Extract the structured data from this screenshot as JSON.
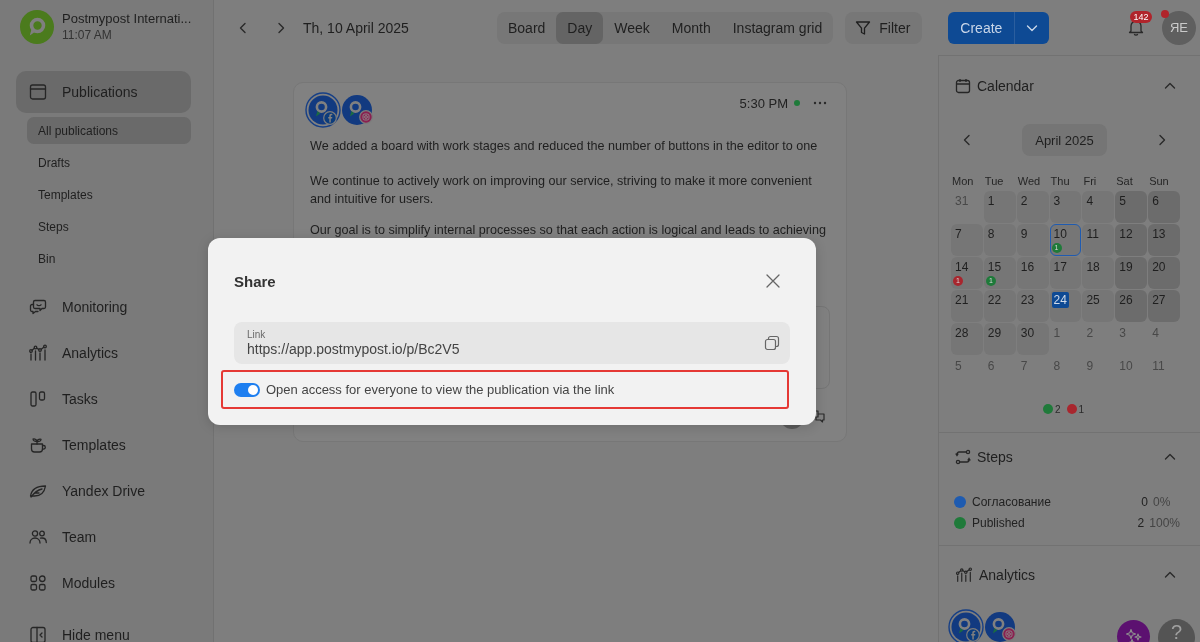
{
  "account": {
    "name": "Postmypost Internati...",
    "time": "11:07 AM"
  },
  "sidebar": {
    "items": [
      {
        "label": "Publications",
        "selected": true,
        "children": [
          {
            "label": "All publications",
            "selected": true
          },
          {
            "label": "Drafts",
            "selected": false
          },
          {
            "label": "Templates",
            "selected": false
          },
          {
            "label": "Steps",
            "selected": false
          },
          {
            "label": "Bin",
            "selected": false
          }
        ]
      },
      {
        "label": "Monitoring",
        "selected": false
      },
      {
        "label": "Analytics",
        "selected": false
      },
      {
        "label": "Tasks",
        "selected": false
      },
      {
        "label": "Templates",
        "selected": false
      },
      {
        "label": "Yandex Drive",
        "selected": false
      },
      {
        "label": "Team",
        "selected": false
      },
      {
        "label": "Modules",
        "selected": false
      },
      {
        "label": "Hide menu",
        "selected": false
      }
    ]
  },
  "toolbar": {
    "date": "Th, 10 April 2025",
    "views": [
      {
        "label": "Board",
        "selected": false
      },
      {
        "label": "Day",
        "selected": true
      },
      {
        "label": "Week",
        "selected": false
      },
      {
        "label": "Month",
        "selected": false
      },
      {
        "label": "Instagram grid",
        "selected": false
      }
    ],
    "filter": "Filter",
    "create": "Create",
    "notifications": "142",
    "profile": {
      "initials": "ЯЕ",
      "alert": true
    }
  },
  "post": {
    "time": "5:30 PM",
    "published": true,
    "accounts": [
      {
        "kind": "facebook",
        "selected": true
      },
      {
        "kind": "instagram",
        "selected": false
      }
    ],
    "paragraphs": [
      "We added a board with work stages and reduced the number of buttons in the editor to one",
      "We continue to actively work on improving our service, striving to make it more convenient and intuitive for users.",
      "Our goal is to simplify internal processes so that each action is logical and leads to achieving"
    ]
  },
  "calendar": {
    "title": "Calendar",
    "expanded": true,
    "month": "April 2025",
    "weekdays": [
      "Mon",
      "Tue",
      "Wed",
      "Thu",
      "Fri",
      "Sat",
      "Sun"
    ],
    "weeks": [
      [
        {
          "day": "31",
          "outside": true,
          "selected": false,
          "today": false
        },
        {
          "day": "1",
          "outside": false,
          "selected": false,
          "today": false
        },
        {
          "day": "2",
          "outside": false,
          "selected": false,
          "today": false
        },
        {
          "day": "3",
          "outside": false,
          "selected": false,
          "today": false
        },
        {
          "day": "4",
          "outside": false,
          "selected": false,
          "today": false
        },
        {
          "day": "5",
          "outside": false,
          "selected": false,
          "today": false
        },
        {
          "day": "6",
          "outside": false,
          "selected": false,
          "today": false
        }
      ],
      [
        {
          "day": "7",
          "outside": false,
          "selected": false,
          "today": false
        },
        {
          "day": "8",
          "outside": false,
          "selected": false,
          "today": false
        },
        {
          "day": "9",
          "outside": false,
          "selected": false,
          "today": false
        },
        {
          "day": "10",
          "outside": false,
          "selected": true,
          "today": false,
          "badge": {
            "count": "1",
            "color": "#1f7a3a"
          }
        },
        {
          "day": "11",
          "outside": false,
          "selected": false,
          "today": false
        },
        {
          "day": "12",
          "outside": false,
          "selected": false,
          "today": false
        },
        {
          "day": "13",
          "outside": false,
          "selected": false,
          "today": false
        }
      ],
      [
        {
          "day": "14",
          "outside": false,
          "selected": false,
          "today": false,
          "badge": {
            "count": "1",
            "color": "#a8262e"
          }
        },
        {
          "day": "15",
          "outside": false,
          "selected": false,
          "today": false,
          "badge": {
            "count": "1",
            "color": "#1f7a3a"
          }
        },
        {
          "day": "16",
          "outside": false,
          "selected": false,
          "today": false
        },
        {
          "day": "17",
          "outside": false,
          "selected": false,
          "today": false
        },
        {
          "day": "18",
          "outside": false,
          "selected": false,
          "today": false
        },
        {
          "day": "19",
          "outside": false,
          "selected": false,
          "today": false
        },
        {
          "day": "20",
          "outside": false,
          "selected": false,
          "today": false
        }
      ],
      [
        {
          "day": "21",
          "outside": false,
          "selected": false,
          "today": false
        },
        {
          "day": "22",
          "outside": false,
          "selected": false,
          "today": false
        },
        {
          "day": "23",
          "outside": false,
          "selected": false,
          "today": false
        },
        {
          "day": "24",
          "outside": false,
          "selected": false,
          "today": true
        },
        {
          "day": "25",
          "outside": false,
          "selected": false,
          "today": false
        },
        {
          "day": "26",
          "outside": false,
          "selected": false,
          "today": false
        },
        {
          "day": "27",
          "outside": false,
          "selected": false,
          "today": false
        }
      ],
      [
        {
          "day": "28",
          "outside": false,
          "selected": false,
          "today": false
        },
        {
          "day": "29",
          "outside": false,
          "selected": false,
          "today": false
        },
        {
          "day": "30",
          "outside": false,
          "selected": false,
          "today": false
        },
        {
          "day": "1",
          "outside": true,
          "selected": false,
          "today": false
        },
        {
          "day": "2",
          "outside": true,
          "selected": false,
          "today": false
        },
        {
          "day": "3",
          "outside": true,
          "selected": false,
          "today": false
        },
        {
          "day": "4",
          "outside": true,
          "selected": false,
          "today": false
        }
      ],
      [
        {
          "day": "5",
          "outside": true,
          "selected": false,
          "today": false
        },
        {
          "day": "6",
          "outside": true,
          "selected": false,
          "today": false
        },
        {
          "day": "7",
          "outside": true,
          "selected": false,
          "today": false
        },
        {
          "day": "8",
          "outside": true,
          "selected": false,
          "today": false
        },
        {
          "day": "9",
          "outside": true,
          "selected": false,
          "today": false
        },
        {
          "day": "10",
          "outside": true,
          "selected": false,
          "today": false
        },
        {
          "day": "11",
          "outside": true,
          "selected": false,
          "today": false
        }
      ]
    ],
    "legend": [
      {
        "color": "#1f7a3a",
        "count": "2"
      },
      {
        "color": "#a8262e",
        "count": "1"
      }
    ]
  },
  "steps": {
    "title": "Steps",
    "expanded": true,
    "items": [
      {
        "name": "Согласование",
        "color": "#1e5bb0",
        "count": "0",
        "percent": "0%"
      },
      {
        "name": "Published",
        "color": "#1f7a3a",
        "count": "2",
        "percent": "100%"
      }
    ]
  },
  "analytics": {
    "title": "Analytics",
    "expanded": true,
    "accounts": [
      {
        "kind": "facebook",
        "selected": true
      },
      {
        "kind": "instagram",
        "selected": false
      }
    ]
  },
  "help": "?",
  "share_dialog": {
    "title": "Share",
    "link_label": "Link",
    "link": "https://app.postmypost.io/p/Bc2V5",
    "toggle": {
      "label": "Open access for everyone to view the publication via the link",
      "on": true,
      "highlighted": true
    }
  }
}
